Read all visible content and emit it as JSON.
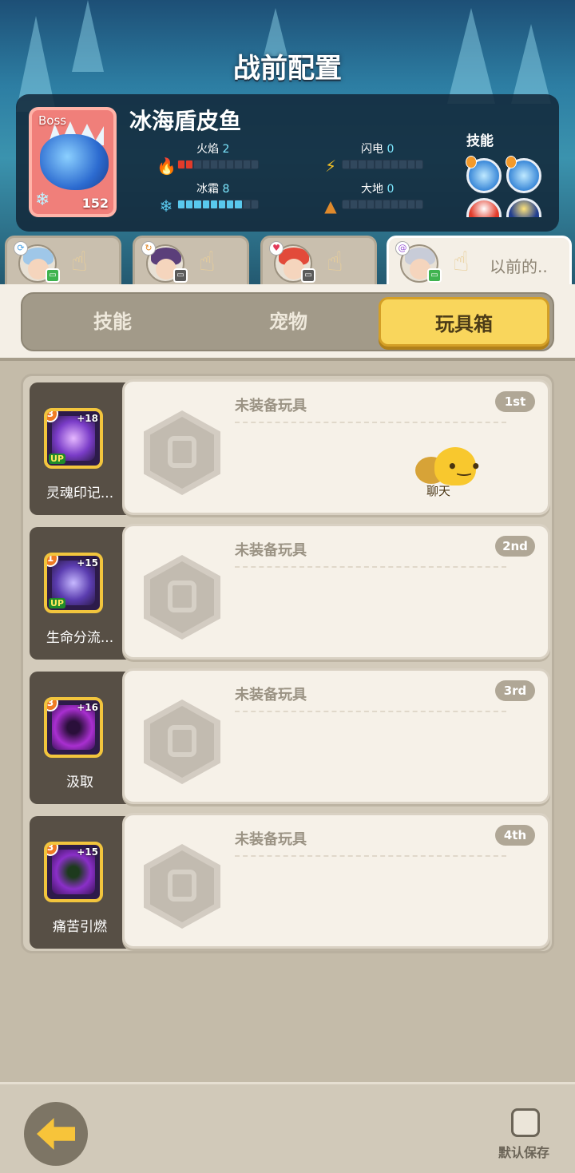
{
  "header": {
    "title": "战前配置"
  },
  "boss": {
    "badge": "Boss",
    "name": "冰海盾皮鱼",
    "level": "152",
    "stats": [
      {
        "name": "火焰",
        "value": "2",
        "icon": "fire-icon",
        "color": "#e23b2a",
        "fill": 2
      },
      {
        "name": "闪电",
        "value": "0",
        "icon": "lightning-icon",
        "color": "#f4c125",
        "fill": 0
      },
      {
        "name": "冰霜",
        "value": "8",
        "icon": "snowflake-icon",
        "color": "#59c9ee",
        "fill": 8
      },
      {
        "name": "大地",
        "value": "0",
        "icon": "earth-icon",
        "color": "#e08a2c",
        "fill": 0
      }
    ],
    "skills_label": "技能"
  },
  "party": [
    {
      "label": ""
    },
    {
      "label": ""
    },
    {
      "label": ""
    },
    {
      "label": "以前的.."
    }
  ],
  "segments": {
    "items": [
      "技能",
      "宠物",
      "玩具箱"
    ],
    "active": 2
  },
  "rows": [
    {
      "skill": "灵魂印记...",
      "level": "3",
      "plus": "+18",
      "up": "UP",
      "toy_label": "未装备玩具",
      "rank": "1st",
      "color": "#7a3cc8"
    },
    {
      "skill": "生命分流...",
      "level": "1",
      "plus": "+15",
      "up": "UP",
      "toy_label": "未装备玩具",
      "rank": "2nd",
      "color": "#5b3db0"
    },
    {
      "skill": "汲取",
      "level": "3",
      "plus": "+16",
      "up": "",
      "toy_label": "未装备玩具",
      "rank": "3rd",
      "color": "#a92fd0"
    },
    {
      "skill": "痛苦引燃",
      "level": "3",
      "plus": "+15",
      "up": "",
      "toy_label": "未装备玩具",
      "rank": "4th",
      "color": "#8a2fc8"
    }
  ],
  "chat": {
    "label": "聊天"
  },
  "footer": {
    "default_save": "默认保存"
  }
}
